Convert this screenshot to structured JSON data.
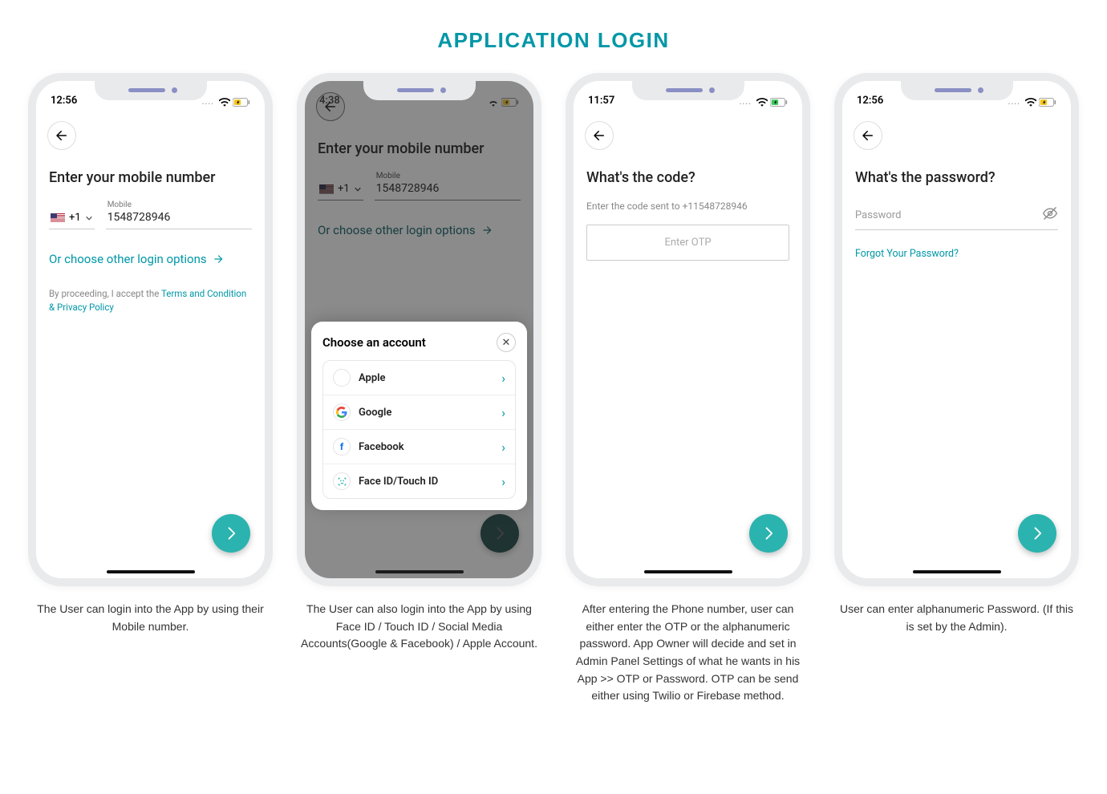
{
  "page_title": "APPLICATION LOGIN",
  "colors": {
    "accent": "#0097a7",
    "fab": "#2bb3af"
  },
  "screens": [
    {
      "time": "12:56",
      "title": "Enter your mobile number",
      "country_code": "+1",
      "mobile_label": "Mobile",
      "mobile_value": "1548728946",
      "other_login": "Or choose other login options",
      "terms_prefix": "By proceeding, I accept the ",
      "terms_link": "Terms and Condition & Privacy Policy",
      "caption": "The User can login into the App by using their Mobile number."
    },
    {
      "time": "4:38",
      "title": "Enter your mobile number",
      "country_code": "+1",
      "mobile_label": "Mobile",
      "mobile_value": "1548728946",
      "other_login": "Or choose other login options",
      "sheet_title": "Choose an account",
      "accounts": [
        {
          "label": "Apple"
        },
        {
          "label": "Google"
        },
        {
          "label": "Facebook"
        },
        {
          "label": "Face ID/Touch ID"
        }
      ],
      "caption": "The User can also login into the App by using Face ID / Touch ID / Social Media Accounts(Google & Facebook) / Apple Account."
    },
    {
      "time": "11:57",
      "title": "What's the code?",
      "code_hint": "Enter the code  sent to +11548728946",
      "otp_placeholder": "Enter OTP",
      "caption": "After entering the Phone number, user can either enter the OTP or the alphanumeric password. App Owner will decide and set in Admin Panel Settings of what he wants in his App >> OTP or Password. OTP can be send either using Twilio or Firebase method."
    },
    {
      "time": "12:56",
      "title": "What's the password?",
      "password_placeholder": "Password",
      "forgot": "Forgot Your Password?",
      "caption": "User can enter alphanumeric Password. (If this is set by the Admin)."
    }
  ]
}
